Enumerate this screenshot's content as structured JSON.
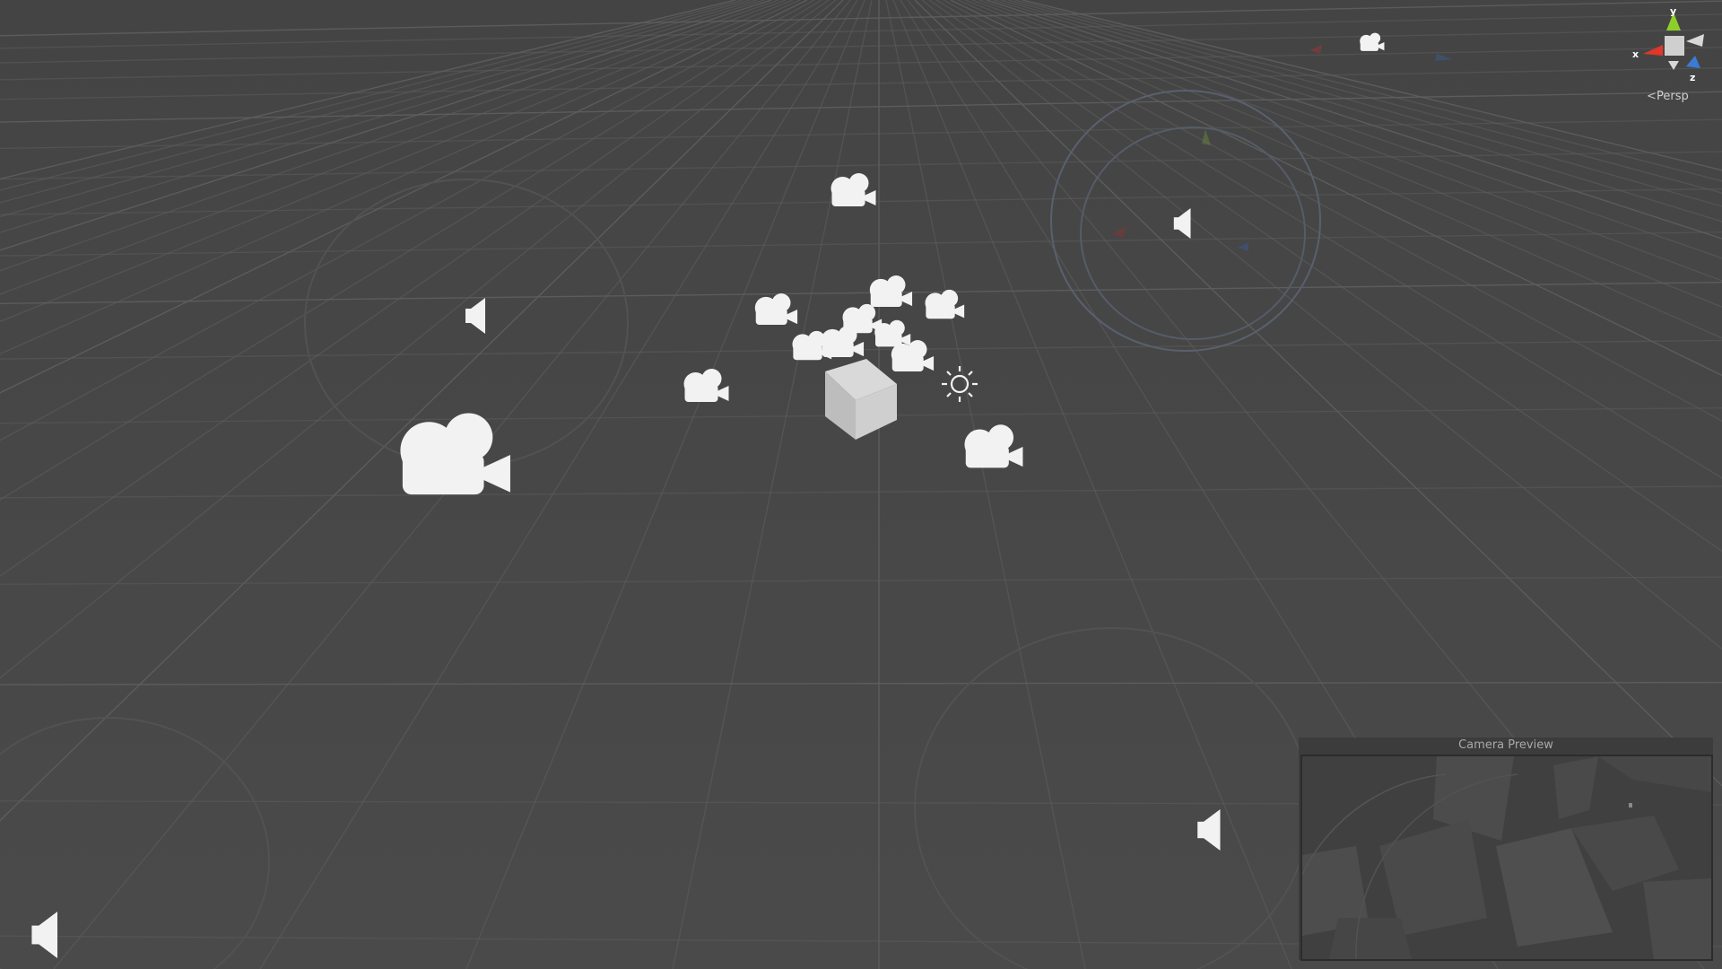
{
  "scene": {
    "projection_label": "Persp",
    "gizmo": {
      "x_label": "x",
      "y_label": "y",
      "z_label": "z",
      "colors": {
        "x": "#e0362b",
        "y": "#8fce2a",
        "z": "#3a7bd5",
        "neutral": "#d8d8d8"
      }
    },
    "icons": {
      "camera": "video-camera-icon",
      "audio": "speaker-icon",
      "light": "sun-icon",
      "cube": "cube-mesh"
    },
    "colors": {
      "background": "#474747",
      "grid": "#5c5c5c",
      "icon": "#f2f2f2"
    }
  },
  "camera_preview": {
    "title": "Camera Preview"
  }
}
